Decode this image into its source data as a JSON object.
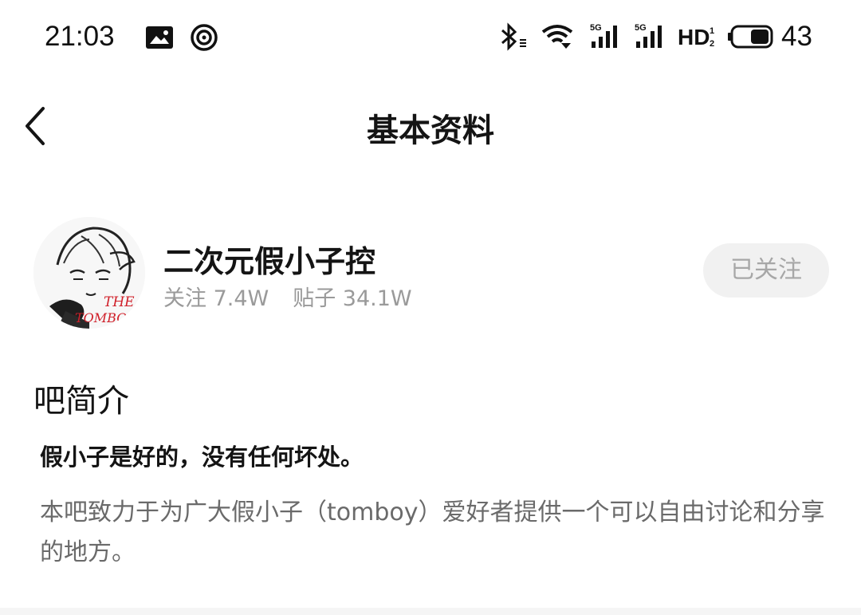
{
  "status_bar": {
    "time": "21:03",
    "battery_level": "43",
    "network_label": "5G",
    "hd_label": "HD"
  },
  "nav": {
    "title": "基本资料",
    "back_icon": "chevron-left-icon"
  },
  "forum": {
    "name": "二次元假小子控",
    "followers_label": "关注 7.4W",
    "posts_label": "贴子 34.1W",
    "follow_button_label": "已关注",
    "avatar_text_1": "THE",
    "avatar_text_2": "TOMBO"
  },
  "intro": {
    "heading": "吧简介",
    "slogan": "假小子是好的，没有任何坏处。",
    "description": "本吧致力于为广大假小子（tomboy）爱好者提供一个可以自由讨论和分享的地方。"
  },
  "colors": {
    "follow_button_bg": "#f1f1f1",
    "muted_text": "#9a9a9a",
    "avatar_accent": "#d0202a"
  }
}
